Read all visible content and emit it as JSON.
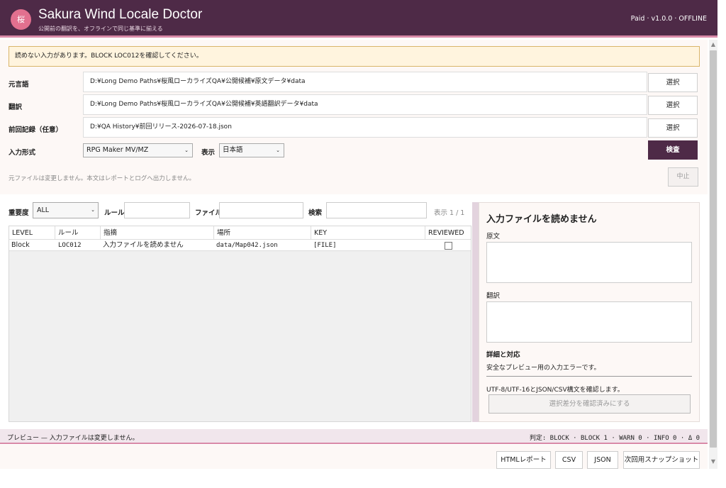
{
  "header": {
    "logo_char": "桜",
    "title": "Sakura Wind Locale Doctor",
    "subtitle": "公開前の翻訳を、オフラインで同じ基準に揃える",
    "status": "Paid · v1.0.0 · OFFLINE"
  },
  "warning": "読めない入力があります。BLOCK LOC012を確認してください。",
  "form": {
    "source_label": "元言語",
    "source_path": "D:¥Long Demo Paths¥桜風ローカライズQA¥公開候補¥原文データ¥data",
    "translation_label": "翻訳",
    "translation_path": "D:¥Long Demo Paths¥桜風ローカライズQA¥公開候補¥英語翻訳データ¥data",
    "previous_label": "前回記録（任意）",
    "previous_path": "D:¥QA History¥前回リリース-2026-07-18.json",
    "pick_label": "選択",
    "format_label": "入力形式",
    "format_value": "RPG Maker MV/MZ",
    "display_label": "表示",
    "display_value": "日本語",
    "scan_label": "検査",
    "note": "元ファイルは変更しません。本文はレポートとログへ出力しません。",
    "stop_label": "中止"
  },
  "filters": {
    "severity_label": "重要度",
    "severity_value": "ALL",
    "rule_label": "ルール",
    "file_label": "ファイル",
    "search_label": "検索",
    "count": "表示 1 / 1"
  },
  "table": {
    "columns": [
      "LEVEL",
      "ルール",
      "指摘",
      "場所",
      "KEY",
      "REVIEWED"
    ],
    "rows": [
      {
        "level": "Block",
        "rule": "LOC012",
        "issue": "入力ファイルを読めません",
        "location": "data/Map042.json",
        "key": "[FILE]",
        "reviewed": false
      }
    ]
  },
  "detail": {
    "title": "入力ファイルを読めません",
    "original_label": "原文",
    "translation_label": "翻訳",
    "details_label": "詳細と対応",
    "details_text": "安全なプレビュー用の入力エラーです。",
    "advice": "UTF-8/UTF-16とJSON/CSV構文を確認します。",
    "mark_button": "選択差分を確認済みにする"
  },
  "status": {
    "left": "プレビュー — 入力ファイルは変更しません。",
    "right": "判定: BLOCK · BLOCK 1 · WARN 0 · INFO 0 · Δ 0"
  },
  "footer": {
    "html_report": "HTMLレポート",
    "csv": "CSV",
    "json": "JSON",
    "snapshot": "次回用スナップショット"
  }
}
